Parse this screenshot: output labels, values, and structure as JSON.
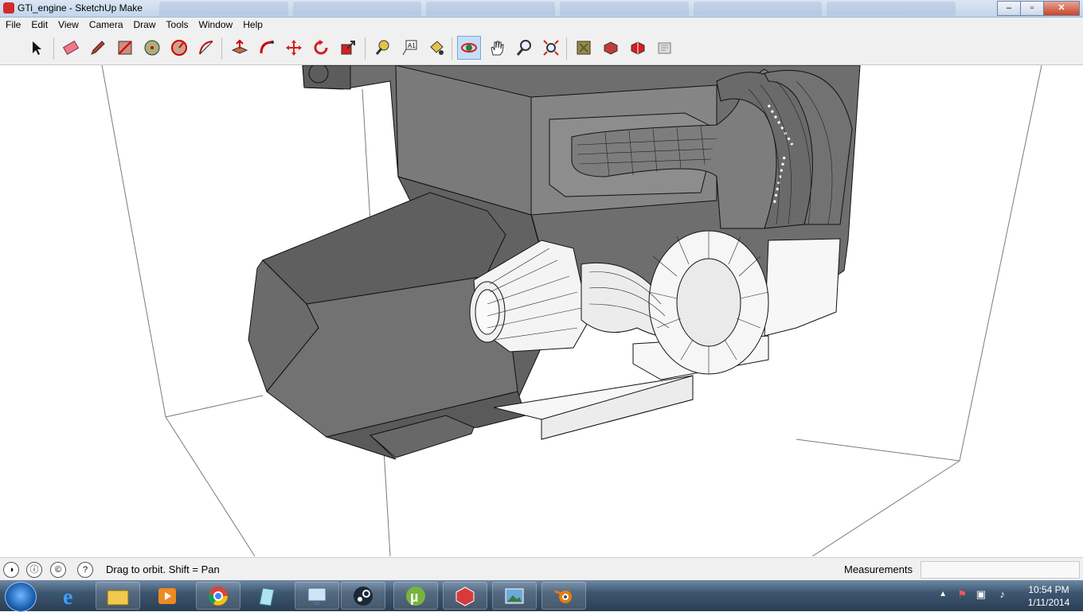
{
  "window": {
    "title": "GTi_engine - SketchUp Make"
  },
  "menu": [
    "File",
    "Edit",
    "View",
    "Camera",
    "Draw",
    "Tools",
    "Window",
    "Help"
  ],
  "toolbar": {
    "tools": [
      "select-icon",
      "eraser-icon",
      "pencil-icon",
      "rectangle-icon",
      "circle-icon",
      "polygon-icon",
      "arc-icon",
      "push-pull-icon",
      "follow-me-icon",
      "move-icon",
      "rotate-icon",
      "scale-icon",
      "tape-measure-icon",
      "text-icon",
      "paint-bucket-icon",
      "orbit-icon",
      "pan-icon",
      "zoom-icon",
      "zoom-extents-icon",
      "3d-warehouse-icon",
      "extension-warehouse-icon",
      "share-model-icon",
      "layout-icon"
    ],
    "active_tool": "orbit-icon"
  },
  "status": {
    "hint": "Drag to orbit.  Shift = Pan",
    "measurements_label": "Measurements",
    "measurements_value": ""
  },
  "taskbar": {
    "apps": [
      "internet-explorer-icon",
      "file-explorer-icon",
      "media-player-icon",
      "chrome-icon",
      "app-icon",
      "control-panel-icon",
      "steam-icon",
      "utorrent-icon",
      "sketchup-icon",
      "image-viewer-icon",
      "blender-icon"
    ],
    "time": "10:54 PM",
    "date": "1/11/2014"
  },
  "colors": {
    "accent_red": "#d32b2b",
    "model_gray": "#6f6f6f",
    "model_white": "#f7f7f7"
  }
}
